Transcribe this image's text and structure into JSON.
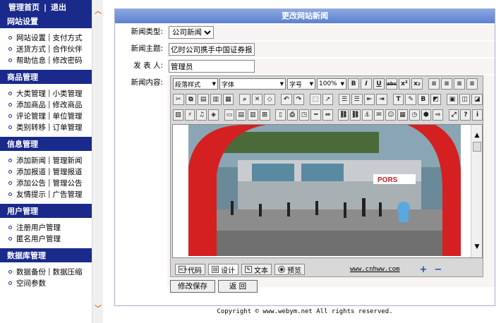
{
  "sidebar": {
    "top": {
      "home": "管理首页",
      "sep": "|",
      "logout": "退出"
    },
    "sections": [
      {
        "title": "网站设置",
        "rows": [
          [
            "网站设置",
            "支付方式"
          ],
          [
            "送货方式",
            "合作伙伴"
          ],
          [
            "帮助信息",
            "修改密码"
          ]
        ]
      },
      {
        "title": "商品管理",
        "rows": [
          [
            "大类管理",
            "小类管理"
          ],
          [
            "添加商品",
            "修改商品"
          ],
          [
            "评论管理",
            "单位管理"
          ],
          [
            "类别转移",
            "订单管理"
          ]
        ]
      },
      {
        "title": "信息管理",
        "rows": [
          [
            "添加新闻",
            "管理新闻"
          ],
          [
            "添加报道",
            "管理报道"
          ],
          [
            "添加公告",
            "管理公告"
          ],
          [
            "友情提示",
            "广告管理"
          ]
        ]
      },
      {
        "title": "用户管理",
        "rows": [
          [
            "注册用户管理"
          ],
          [
            "匿名用户管理"
          ]
        ]
      },
      {
        "title": "数据库管理",
        "rows": [
          [
            "数据备份",
            "数据压缩"
          ],
          [
            "空间参数"
          ]
        ]
      }
    ]
  },
  "panel": {
    "title": "更改网站新闻",
    "type_label": "新闻类型:",
    "type_value": "公司新闻",
    "subject_label": "新闻主题:",
    "subject_value": "亿时公司携手中国证券报记",
    "author_label": "发 表 人:",
    "author_value": "管理员",
    "content_label": "新闻内容:"
  },
  "editor": {
    "para_style": "段落样式",
    "font": "字体",
    "size": "字号",
    "zoom": "100%",
    "tabs": [
      "代码",
      "设计",
      "文本",
      "预览"
    ],
    "active_tab": "设计",
    "link": "www.cnhww.com",
    "photo_sign": "PORS"
  },
  "buttons": {
    "save": "修改保存",
    "back": "返 回"
  },
  "footer": "Copyright © www.webym.net All rights reserved."
}
